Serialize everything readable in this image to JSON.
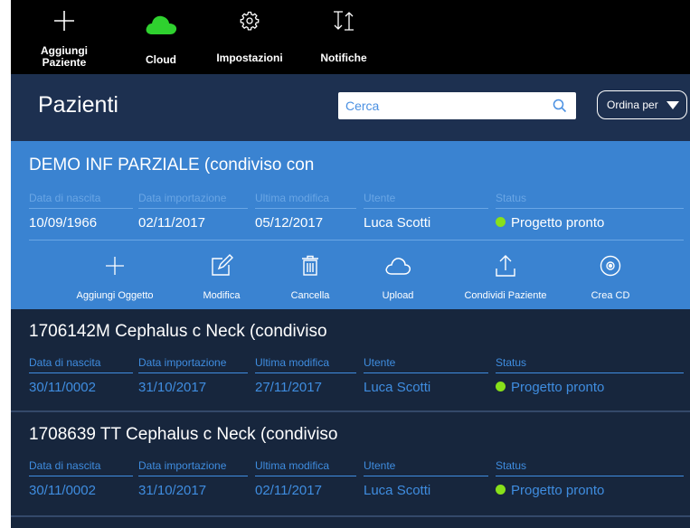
{
  "toolbar": {
    "add_patient_label": "Aggiungi\nPaziente",
    "cloud_label": "Cloud",
    "settings_label": "Impostazioni",
    "notifications_label": "Notifiche"
  },
  "header": {
    "title": "Pazienti",
    "search_placeholder": "Cerca",
    "sort_label": "Ordina per"
  },
  "columns": {
    "birth": "Data di nascita",
    "import": "Data importazione",
    "modified": "Ultima modifica",
    "user": "Utente",
    "status": "Status"
  },
  "patients": [
    {
      "name": "DEMO INF PARZIALE (condiviso con",
      "birth": "10/09/1966",
      "import": "02/11/2017",
      "modified": "05/12/2017",
      "user": "Luca Scotti",
      "status": "Progetto pronto"
    },
    {
      "name": "1706142M Cephalus c Neck (condiviso",
      "birth": "30/11/0002",
      "import": "31/10/2017",
      "modified": "27/11/2017",
      "user": "Luca Scotti",
      "status": "Progetto pronto"
    },
    {
      "name": "1708639 TT Cephalus c Neck (condiviso",
      "birth": "30/11/0002",
      "import": "31/10/2017",
      "modified": "02/11/2017",
      "user": "Luca Scotti",
      "status": "Progetto pronto"
    }
  ],
  "actions": {
    "add_object": "Aggiungi Oggetto",
    "edit": "Modifica",
    "delete": "Cancella",
    "upload": "Upload",
    "share": "Condividi Paziente",
    "burn_cd": "Crea CD"
  },
  "colors": {
    "toolbar_bg": "#000000",
    "header_bg": "#1d3050",
    "list_bg": "#17263d",
    "selected_bg": "#3a83d1",
    "cloud_icon": "#2fd12f",
    "status_ready": "#88e01a",
    "column_accent": "#3f8de0"
  }
}
